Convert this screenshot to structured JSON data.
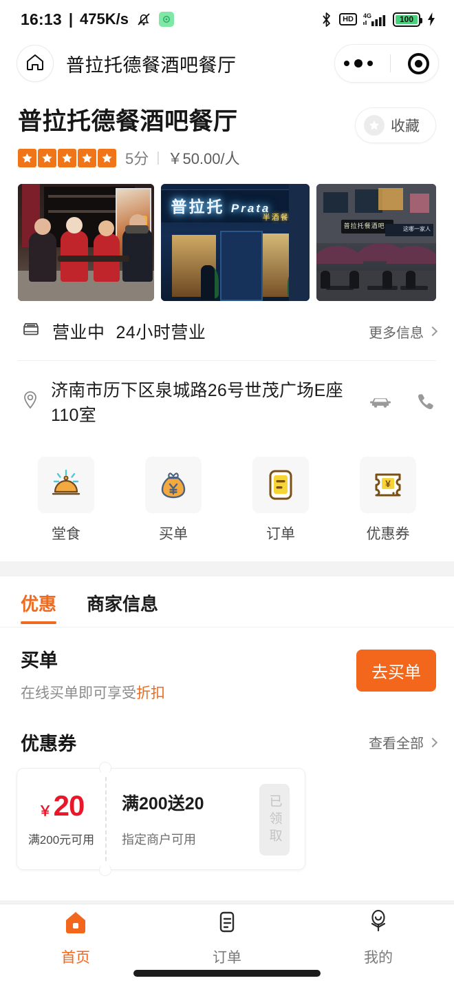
{
  "status_bar": {
    "time": "16:13",
    "separator": "|",
    "network_speed": "475K/s",
    "mute_icon": "bell-muted-icon",
    "app_chip_icon": "screen-recorder-icon",
    "bluetooth_icon": "bluetooth-icon",
    "hd_label": "HD",
    "signal_label": "4G",
    "battery_level": "100",
    "charging_icon": "lightning-icon"
  },
  "nav": {
    "home_icon": "home-icon",
    "title": "普拉托德餐酒吧餐厅",
    "more_icon": "more-dots-icon",
    "close_icon": "target-circle-icon"
  },
  "shop": {
    "name": "普拉托德餐酒吧餐厅",
    "stars": 5,
    "score": "5分",
    "divider": "|",
    "price": "￥50.00/人",
    "favorite_label": "收藏",
    "favorite_icon": "star-icon",
    "star_color": "#ef7518"
  },
  "photos": [
    {
      "name": "photo-terrace-guests",
      "alt": "顾客在店外露天座位用餐"
    },
    {
      "name": "photo-storefront-night",
      "alt": "普拉托 Prata 门店夜景招牌"
    },
    {
      "name": "photo-street-umbrellas",
      "alt": "街边遮阳伞座位夜景"
    }
  ],
  "business": {
    "store_icon": "store-icon",
    "status": "营业中",
    "hours": "24小时营业",
    "more_label": "更多信息",
    "chevron_icon": "chevron-right-icon"
  },
  "address": {
    "pin_icon": "location-pin-icon",
    "text": "济南市历下区泉城路26号世茂广场E座110室",
    "car_icon": "car-icon",
    "phone_icon": "phone-icon"
  },
  "services": [
    {
      "label": "堂食",
      "icon": "dine-in-dome-icon"
    },
    {
      "label": "买单",
      "icon": "money-bag-icon"
    },
    {
      "label": "订单",
      "icon": "order-card-icon"
    },
    {
      "label": "优惠券",
      "icon": "coupon-ticket-icon"
    }
  ],
  "tabs": [
    {
      "label": "优惠",
      "active": true
    },
    {
      "label": "商家信息",
      "active": false
    }
  ],
  "pay_section": {
    "title": "买单",
    "desc_prefix": "在线买单即可享受",
    "desc_highlight": "折扣",
    "button_label": "去买单",
    "button_color": "#f2671b"
  },
  "coupon_section": {
    "title": "优惠券",
    "more_label": "查看全部",
    "chevron_icon": "chevron-right-icon",
    "coupons": [
      {
        "currency": "￥",
        "amount": "20",
        "condition": "满200元可用",
        "title": "满200送20",
        "scope": "指定商户可用",
        "badge": "已领取",
        "amount_color": "#e8182a"
      }
    ]
  },
  "bottom_nav": [
    {
      "label": "首页",
      "icon": "home-filled-icon",
      "active": true
    },
    {
      "label": "订单",
      "icon": "document-icon",
      "active": false
    },
    {
      "label": "我的",
      "icon": "person-icon",
      "active": false
    }
  ],
  "accent_color": "#f2671b"
}
